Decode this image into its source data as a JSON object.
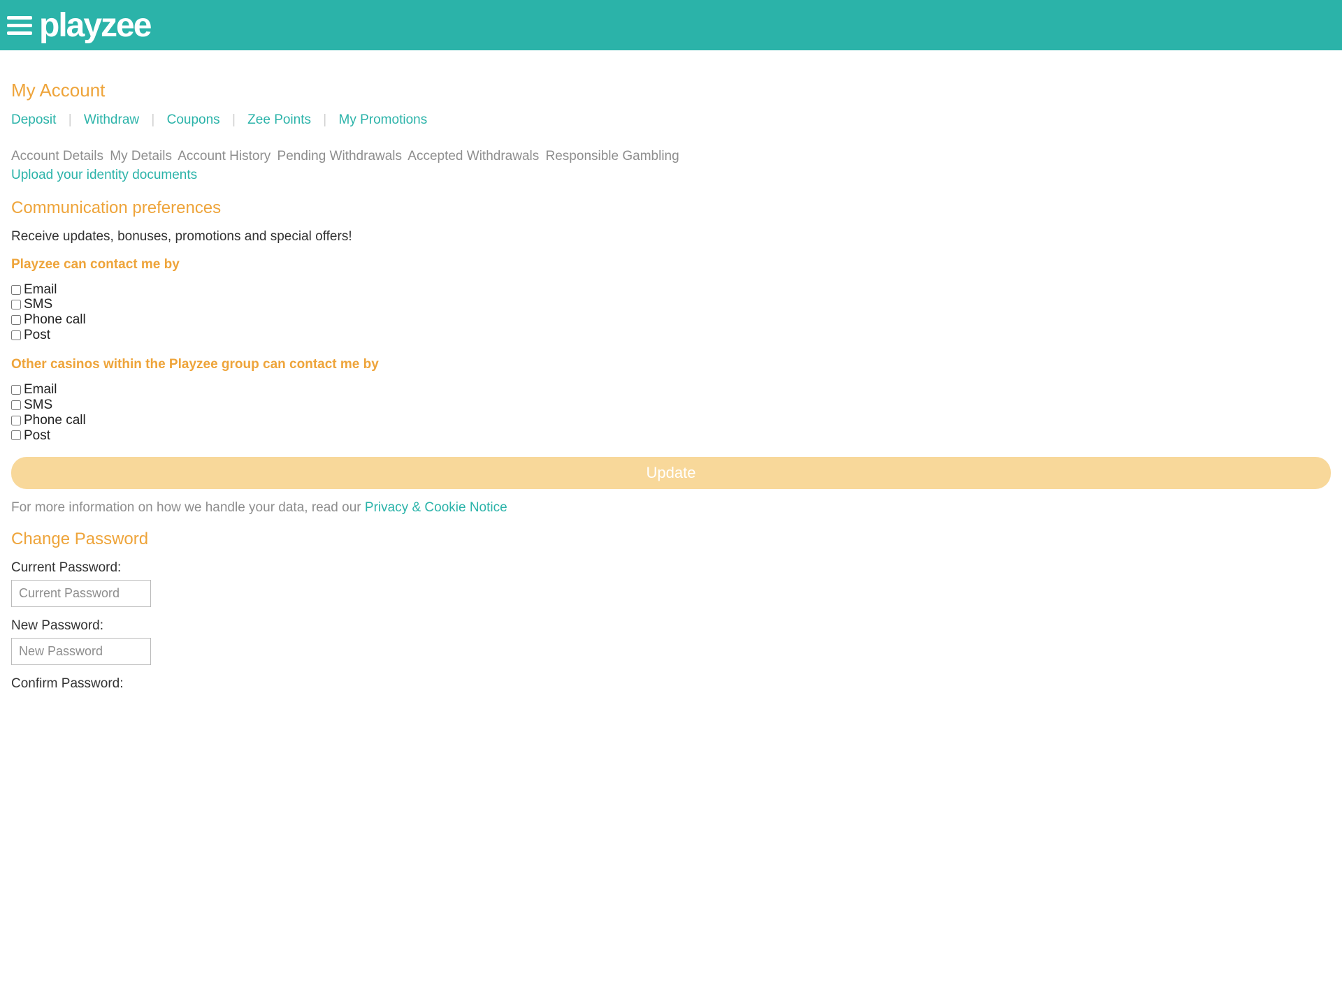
{
  "header": {
    "logo_text": "playzee"
  },
  "page_title": "My Account",
  "nav_links": [
    "Deposit",
    "Withdraw",
    "Coupons",
    "Zee Points",
    "My Promotions"
  ],
  "subnav": [
    "Account Details",
    "My Details",
    "Account History",
    "Pending Withdrawals",
    "Accepted Withdrawals",
    "Responsible Gambling"
  ],
  "upload_link": "Upload your identity documents",
  "comm_prefs": {
    "title": "Communication preferences",
    "desc": "Receive updates, bonuses, promotions and special offers!",
    "group1_label": "Playzee can contact me by",
    "group2_label": "Other casinos within the Playzee group can contact me by",
    "options": [
      "Email",
      "SMS",
      "Phone call",
      "Post"
    ],
    "update_button": "Update"
  },
  "info": {
    "prefix": "For more information on how we handle your data, read our ",
    "link": "Privacy & Cookie Notice"
  },
  "change_pw": {
    "title": "Change Password",
    "current_label": "Current Password:",
    "current_placeholder": "Current Password",
    "new_label": "New Password:",
    "new_placeholder": "New Password",
    "confirm_label": "Confirm Password:"
  }
}
